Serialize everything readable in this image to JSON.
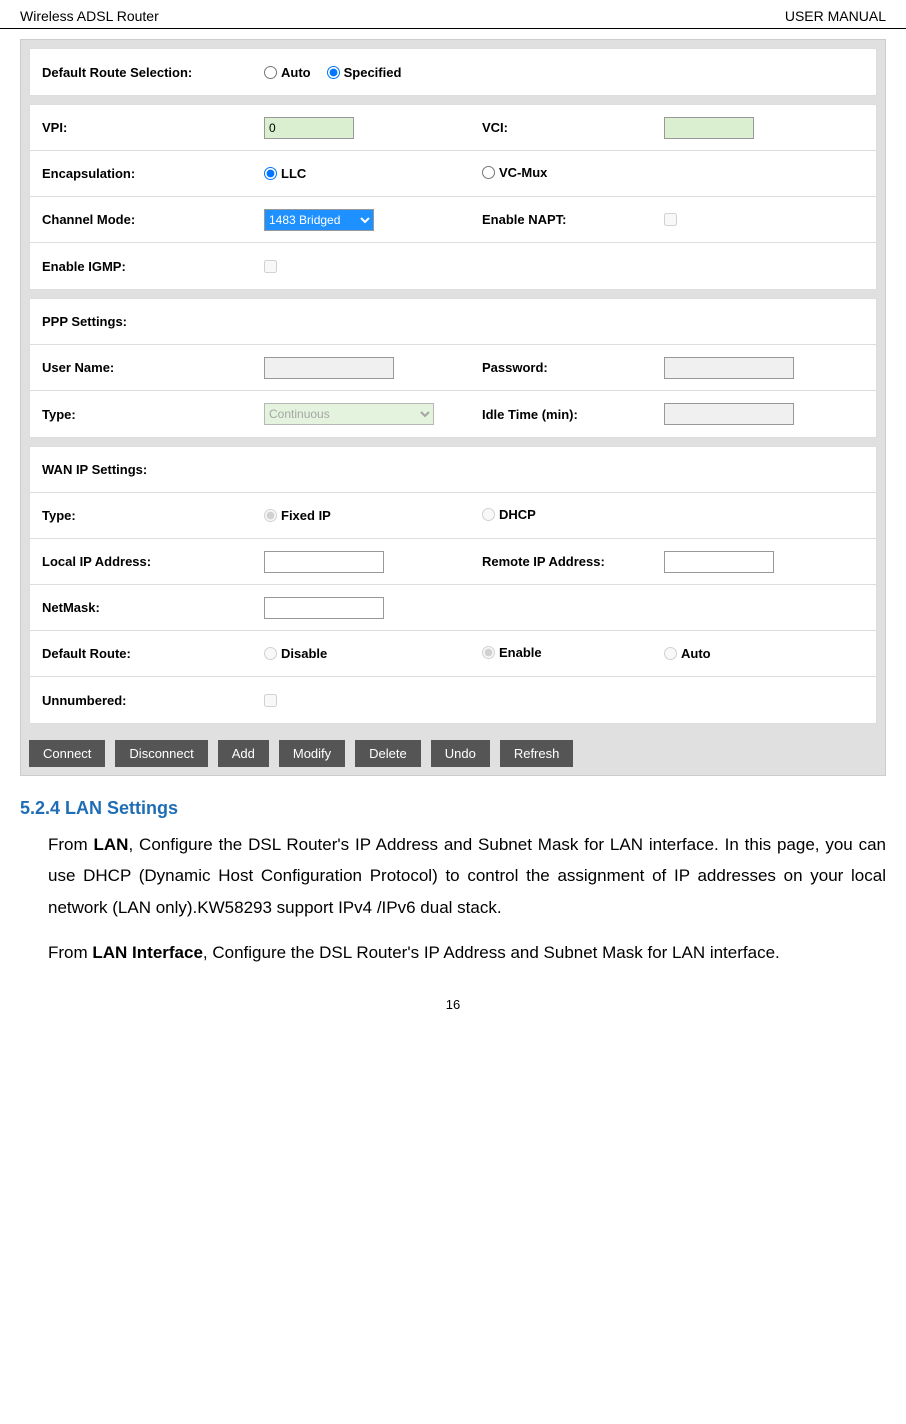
{
  "header": {
    "left": "Wireless ADSL Router",
    "right": "USER MANUAL"
  },
  "ui": {
    "defaultRoute": {
      "label": "Default Route Selection:",
      "option1": "Auto",
      "option2": "Specified"
    },
    "vpi": {
      "label": "VPI:",
      "value": "0"
    },
    "vci": {
      "label": "VCI:",
      "value": ""
    },
    "encapsulation": {
      "label": "Encapsulation:",
      "option1": "LLC",
      "option2": "VC-Mux"
    },
    "channelMode": {
      "label": "Channel Mode:",
      "value": "1483 Bridged"
    },
    "enableNapt": {
      "label": "Enable NAPT:"
    },
    "enableIgmp": {
      "label": "Enable IGMP:"
    },
    "pppSettings": {
      "label": "PPP Settings:"
    },
    "userName": {
      "label": "User Name:",
      "value": ""
    },
    "password": {
      "label": "Password:",
      "value": ""
    },
    "type": {
      "label": "Type:",
      "value": "Continuous"
    },
    "idleTime": {
      "label": "Idle Time (min):",
      "value": ""
    },
    "wanIp": {
      "label": "WAN IP Settings:"
    },
    "wanType": {
      "label": "Type:",
      "option1": "Fixed IP",
      "option2": "DHCP"
    },
    "localIp": {
      "label": "Local IP Address:",
      "value": ""
    },
    "remoteIp": {
      "label": "Remote IP Address:",
      "value": ""
    },
    "netmask": {
      "label": "NetMask:",
      "value": ""
    },
    "defaultRoute2": {
      "label": "Default Route:",
      "option1": "Disable",
      "option2": "Enable",
      "option3": "Auto"
    },
    "unnumbered": {
      "label": "Unnumbered:"
    },
    "buttons": {
      "connect": "Connect",
      "disconnect": "Disconnect",
      "add": "Add",
      "modify": "Modify",
      "delete": "Delete",
      "undo": "Undo",
      "refresh": "Refresh"
    }
  },
  "doc": {
    "sectionHeading": "5.2.4 LAN Settings",
    "para1a": "From ",
    "para1b": "LAN",
    "para1c": ", Configure the DSL Router's IP Address and Subnet Mask for LAN interface. In this page, you can use DHCP (Dynamic Host Configuration Protocol) to control the assignment of IP addresses on your local network (LAN only).KW58293 support IPv4 /IPv6 dual stack.",
    "para2a": "From ",
    "para2b": "LAN Interface",
    "para2c": ", Configure the DSL Router's IP Address and Subnet Mask for LAN interface."
  },
  "pageNumber": "16"
}
